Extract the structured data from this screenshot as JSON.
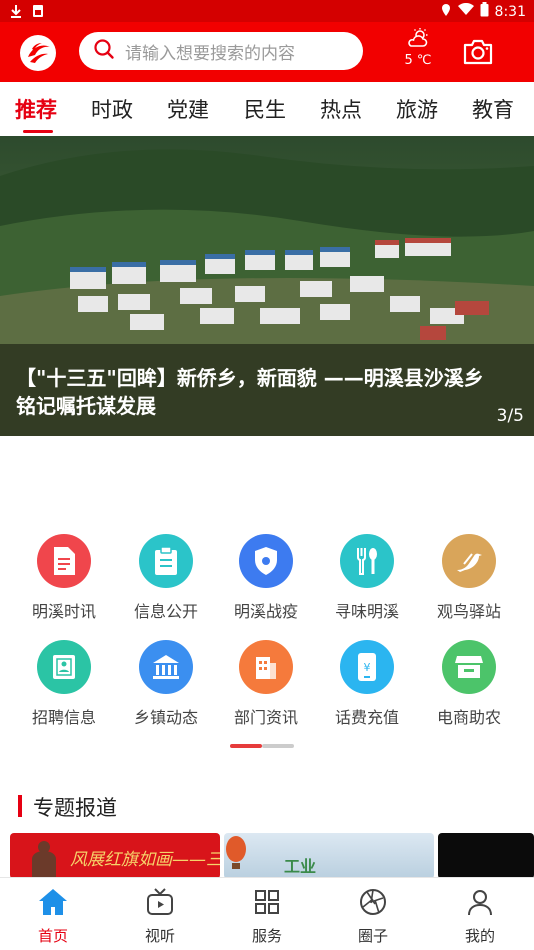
{
  "status_bar": {
    "time": "8:31",
    "icons": [
      "download-icon",
      "sim-icon",
      "location-icon",
      "wifi-icon",
      "battery-icon"
    ]
  },
  "header": {
    "search_placeholder": "请输入想要搜索的内容",
    "weather_temp": "5 ℃",
    "weather_icon": "partly-cloudy-icon",
    "camera_icon": "camera-icon"
  },
  "tabs": [
    {
      "label": "推荐",
      "active": true
    },
    {
      "label": "时政",
      "active": false
    },
    {
      "label": "党建",
      "active": false
    },
    {
      "label": "民生",
      "active": false
    },
    {
      "label": "热点",
      "active": false
    },
    {
      "label": "旅游",
      "active": false
    },
    {
      "label": "教育",
      "active": false
    }
  ],
  "banner": {
    "title": "【\"十三五\"回眸】新侨乡，新面貌 ——明溪县沙溪乡铭记嘱托谋发展",
    "page": "3/5"
  },
  "services": [
    {
      "label": "明溪时讯",
      "icon": "news-icon",
      "color": "#f0464c"
    },
    {
      "label": "信息公开",
      "icon": "clipboard-icon",
      "color": "#2bc4c9"
    },
    {
      "label": "明溪战疫",
      "icon": "shield-icon",
      "color": "#3d7bf0"
    },
    {
      "label": "寻味明溪",
      "icon": "fork-spoon-icon",
      "color": "#2bc4c9"
    },
    {
      "label": "观鸟驿站",
      "icon": "bird-icon",
      "color": "#d9a55a"
    },
    {
      "label": "招聘信息",
      "icon": "resume-icon",
      "color": "#2bc4a5"
    },
    {
      "label": "乡镇动态",
      "icon": "town-hall-icon",
      "color": "#3b8ff0"
    },
    {
      "label": "部门资讯",
      "icon": "building-icon",
      "color": "#f57a3c"
    },
    {
      "label": "话费充值",
      "icon": "phone-recharge-icon",
      "color": "#2bb5f0"
    },
    {
      "label": "电商助农",
      "icon": "shop-icon",
      "color": "#4cc46a"
    }
  ],
  "section": {
    "title": "专题报道"
  },
  "reports": [
    {
      "text": "风展红旗如画——三明"
    },
    {
      "text": "工业"
    },
    {
      "text": ""
    }
  ],
  "bottom_nav": [
    {
      "label": "首页",
      "icon": "home-icon",
      "active": true
    },
    {
      "label": "视听",
      "icon": "tv-icon",
      "active": false
    },
    {
      "label": "服务",
      "icon": "grid-icon",
      "active": false
    },
    {
      "label": "圈子",
      "icon": "aperture-icon",
      "active": false
    },
    {
      "label": "我的",
      "icon": "user-icon",
      "active": false
    }
  ],
  "colors": {
    "brand_red": "#f20000",
    "status_red": "#d40000",
    "accent": "#e60012"
  }
}
